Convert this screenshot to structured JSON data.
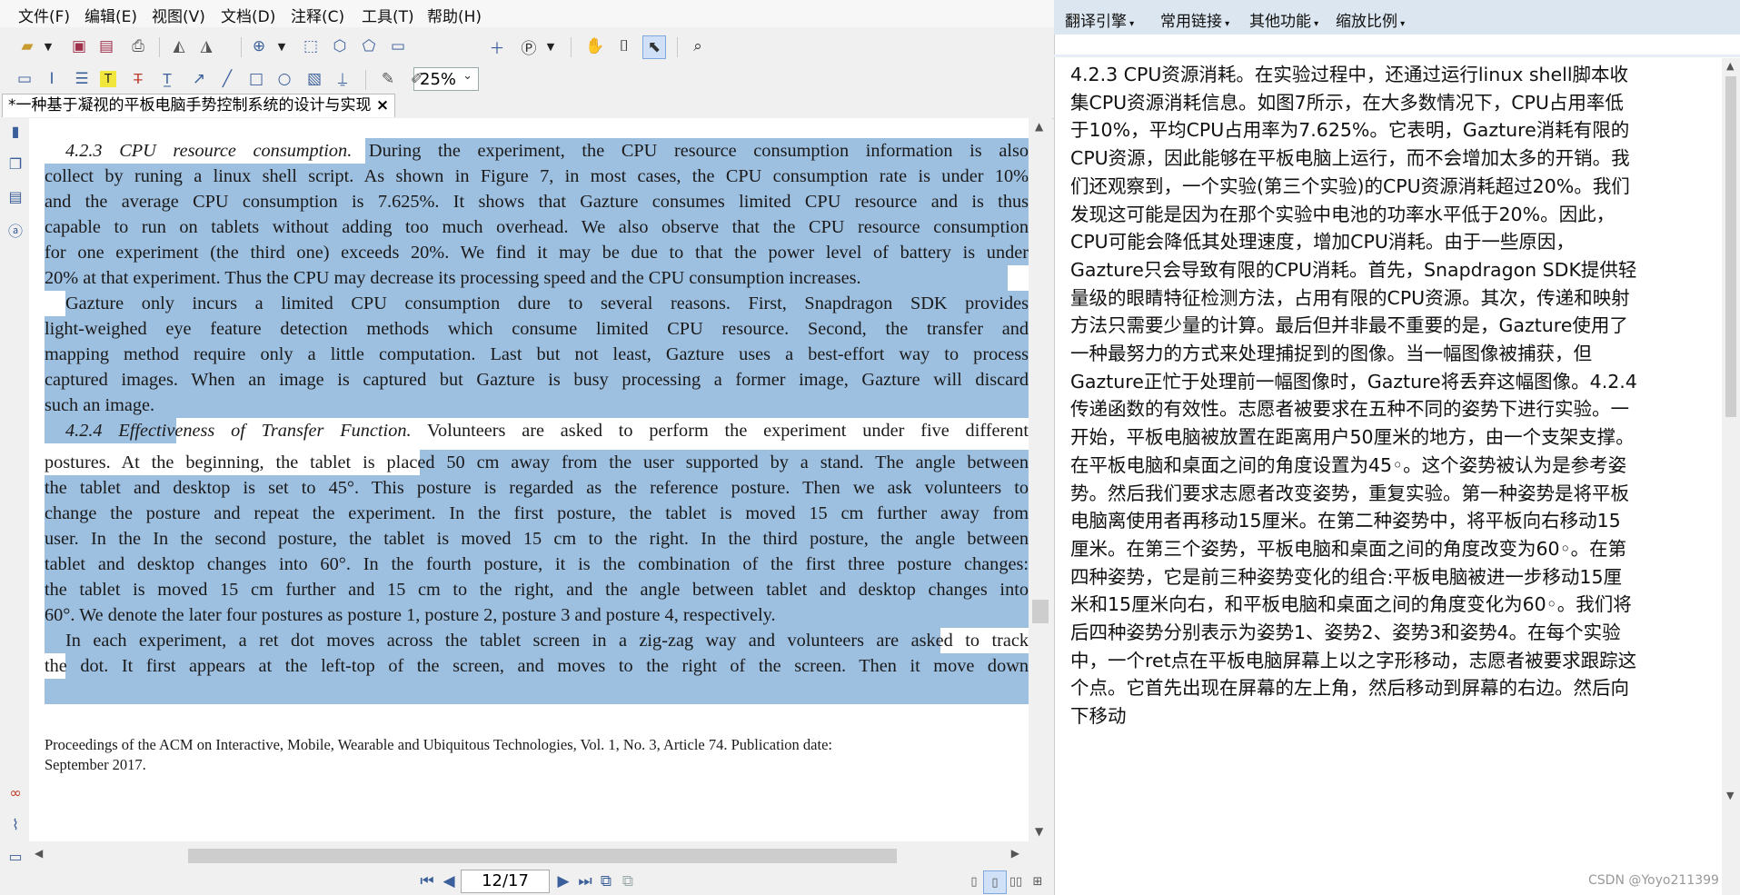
{
  "menu": [
    "文件(F)",
    "编辑(E)",
    "视图(V)",
    "文档(D)",
    "注释(C)",
    "工具(T)",
    "帮助(H)"
  ],
  "toolbar": {
    "zoom_value": "25%"
  },
  "tab": {
    "title": "*一种基于凝视的平板电脑手势控制系统的设计与实现",
    "close": "×"
  },
  "document": {
    "lines": [
      {
        "text": "4.2.3    CPU resource consumption. During the experiment, the CPU resource consumption information is also",
        "indent": true,
        "italic_head": "4.2.3    CPU resource consumption."
      },
      {
        "text": "collect by runing a linux shell script. As shown in Figure 7, in most cases, the CPU consumption rate is under 10%"
      },
      {
        "text": "and the average CPU consumption is 7.625%. It shows that Gazture consumes limited CPU resource and is thus"
      },
      {
        "text": "capable to run on tablets without adding too much overhead. We also observe that the CPU resource consumption"
      },
      {
        "text": "for one experiment (the third one) exceeds 20%. We find it may be due to that the power level of battery is under"
      },
      {
        "text": "20% at that experiment. Thus the CPU may decrease its processing speed and the CPU consumption increases.",
        "last": true
      },
      {
        "text": "Gazture only incurs a limited CPU consumption dure to several reasons. First, Snapdragon SDK provides",
        "indent": true
      },
      {
        "text": "light-weighed eye feature detection methods which consume limited CPU resource. Second, the transfer and"
      },
      {
        "text": "mapping method require only a little computation. Last but not least, Gazture uses a best-effort way to process"
      },
      {
        "text": "captured images. When an image is captured but Gazture is busy processing a former image, Gazture will discard"
      },
      {
        "text": "such an image.",
        "last": true
      },
      {
        "text": "4.2.4    Effectiveness of Transfer Function. Volunteers are asked to perform the experiment under five different",
        "indent": true,
        "italic_head": "4.2.4    Effectiveness of Transfer Function."
      },
      {
        "text": "postures. At the beginning, the tablet is placed 50 cm away from the user supported by a stand. The angle between"
      },
      {
        "text": "the tablet and desktop is set to 45°. This posture is regarded as the reference posture. Then we ask volunteers to"
      },
      {
        "text": "change the posture and repeat the experiment. In the first posture, the tablet is moved 15 cm further away from"
      },
      {
        "text": "user. In the In the second posture, the tablet is moved 15 cm to the right. In the third posture, the angle between"
      },
      {
        "text": "tablet and desktop changes into 60°. In the fourth posture, it is the combination of the first three posture changes:"
      },
      {
        "text": "the tablet is moved 15 cm further and 15 cm to the right, and the angle between tablet and desktop changes into"
      },
      {
        "text": "60°. We denote the later four postures as posture 1, posture 2, posture 3 and posture 4, respectively.",
        "last": true
      },
      {
        "text": "In each experiment, a ret dot moves across the tablet screen in a zig-zag way and volunteers are asked to track",
        "indent": true
      },
      {
        "text": "the dot. It first appears at the left-top of the screen, and moves to the right of the screen. Then it move down"
      }
    ],
    "footer": [
      "Proceedings of the ACM on Interactive, Mobile, Wearable and Ubiquitous Technologies, Vol. 1, No. 3, Article 74. Publication date:",
      "September 2017."
    ]
  },
  "status": {
    "page_indicator": "12/17"
  },
  "translation_panel": {
    "toolbar": [
      "翻译引擎",
      "常用链接",
      "其他功能",
      "缩放比例"
    ],
    "lines": [
      "4.2.3 CPU资源消耗。在实验过程中，还通过运行linux shell脚本收",
      "集CPU资源消耗信息。如图7所示，在大多数情况下，CPU占用率低",
      "于10%，平均CPU占用率为7.625%。它表明，Gazture消耗有限的",
      "CPU资源，因此能够在平板电脑上运行，而不会增加太多的开销。我",
      "们还观察到，一个实验(第三个实验)的CPU资源消耗超过20%。我们",
      "发现这可能是因为在那个实验中电池的功率水平低于20%。因此，",
      "CPU可能会降低其处理速度，增加CPU消耗。由于一些原因，",
      "Gazture只会导致有限的CPU消耗。首先，Snapdragon SDK提供轻",
      "量级的眼睛特征检测方法，占用有限的CPU资源。其次，传递和映射",
      "方法只需要少量的计算。最后但并非最不重要的是，Gazture使用了",
      "一种最努力的方式来处理捕捉到的图像。当一幅图像被捕获，但",
      "Gazture正忙于处理前一幅图像时，Gazture将丢弃这幅图像。4.2.4",
      "传递函数的有效性。志愿者被要求在五种不同的姿势下进行实验。一",
      "开始，平板电脑被放置在距离用户50厘米的地方，由一个支架支撑。",
      "在平板电脑和桌面之间的角度设置为45◦。这个姿势被认为是参考姿",
      "势。然后我们要求志愿者改变姿势，重复实验。第一种姿势是将平板",
      "电脑离使用者再移动15厘米。在第二种姿势中，将平板向右移动15",
      "厘米。在第三个姿势，平板电脑和桌面之间的角度改变为60◦。在第",
      "四种姿势，它是前三种姿势变化的组合:平板电脑被进一步移动15厘",
      "米和15厘米向右，和平板电脑和桌面之间的角度变化为60◦。我们将",
      "后四种姿势分别表示为姿势1、姿势2、姿势3和姿势4。在每个实验",
      "中，一个ret点在平板电脑屏幕上以之字形移动，志愿者被要求跟踪这",
      "个点。它首先出现在屏幕的左上角，然后移动到屏幕的右边。然后向",
      "下移动"
    ],
    "watermark": "CSDN @Yoyo211399"
  }
}
